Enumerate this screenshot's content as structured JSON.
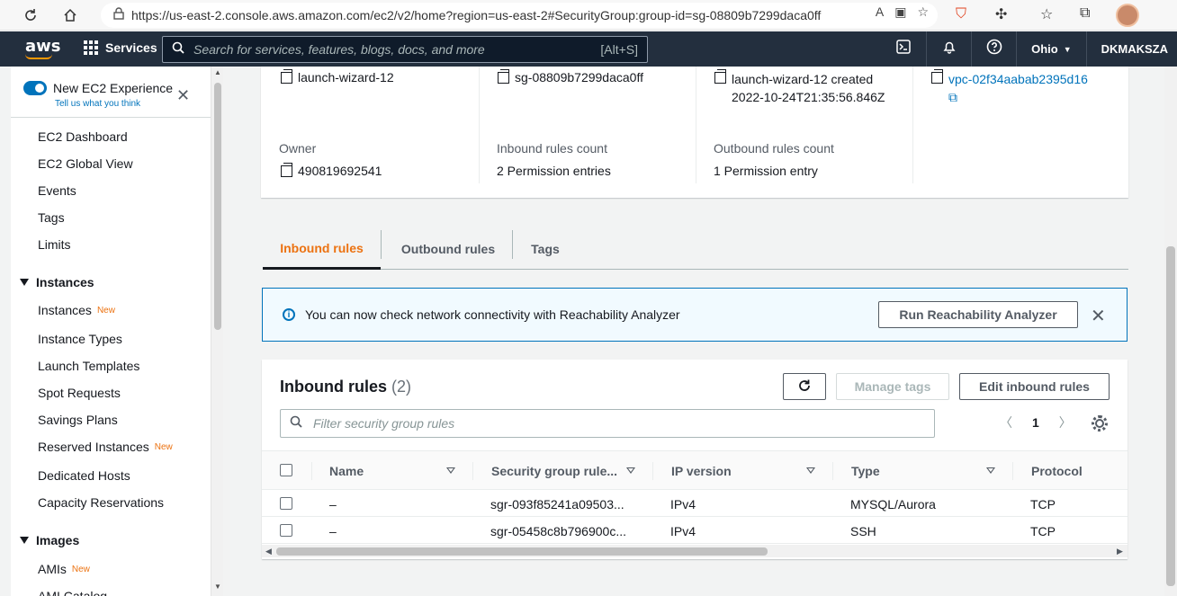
{
  "browser": {
    "url": "https://us-east-2.console.aws.amazon.com/ec2/v2/home?region=us-east-2#SecurityGroup:group-id=sg-08809b7299daca0ff"
  },
  "topnav": {
    "logo": "aws",
    "services_label": "Services",
    "search_placeholder": "Search for services, features, blogs, docs, and more",
    "search_shortcut": "[Alt+S]",
    "region": "Ohio",
    "account": "DKMAKSZA"
  },
  "sidebar": {
    "toggle_label": "New EC2 Experience",
    "toggle_sub": "Tell us what you think",
    "items_top": [
      "EC2 Dashboard",
      "EC2 Global View",
      "Events",
      "Tags",
      "Limits"
    ],
    "section_instances": "Instances",
    "instances_items": [
      {
        "label": "Instances",
        "badge": "New"
      },
      {
        "label": "Instance Types",
        "badge": ""
      },
      {
        "label": "Launch Templates",
        "badge": ""
      },
      {
        "label": "Spot Requests",
        "badge": ""
      },
      {
        "label": "Savings Plans",
        "badge": ""
      },
      {
        "label": "Reserved Instances",
        "badge": "New"
      },
      {
        "label": "Dedicated Hosts",
        "badge": ""
      },
      {
        "label": "Capacity Reservations",
        "badge": ""
      }
    ],
    "section_images": "Images",
    "images_items": [
      {
        "label": "AMIs",
        "badge": "New"
      },
      {
        "label": "AMI Catalog",
        "badge": ""
      }
    ]
  },
  "summary": {
    "row1": {
      "name": "launch-wizard-12",
      "group_id": "sg-08809b7299daca0ff",
      "description": "launch-wizard-12 created 2022-10-24T21:35:56.846Z",
      "vpc": "vpc-02f34aabab2395d16"
    },
    "owner_label": "Owner",
    "owner": "490819692541",
    "inbound_label": "Inbound rules count",
    "inbound": "2 Permission entries",
    "outbound_label": "Outbound rules count",
    "outbound": "1 Permission entry"
  },
  "tabs": [
    "Inbound rules",
    "Outbound rules",
    "Tags"
  ],
  "flash": {
    "message": "You can now check network connectivity with Reachability Analyzer",
    "button": "Run Reachability Analyzer"
  },
  "rules_table": {
    "title": "Inbound rules",
    "count": "(2)",
    "manage_tags": "Manage tags",
    "edit_button": "Edit inbound rules",
    "filter_placeholder": "Filter security group rules",
    "page": "1",
    "columns": [
      "Name",
      "Security group rule...",
      "IP version",
      "Type",
      "Protocol"
    ],
    "rows": [
      {
        "name": "–",
        "rule_id": "sgr-093f85241a09503...",
        "ip_version": "IPv4",
        "type": "MYSQL/Aurora",
        "protocol": "TCP"
      },
      {
        "name": "–",
        "rule_id": "sgr-05458c8b796900c...",
        "ip_version": "IPv4",
        "type": "SSH",
        "protocol": "TCP"
      }
    ]
  }
}
